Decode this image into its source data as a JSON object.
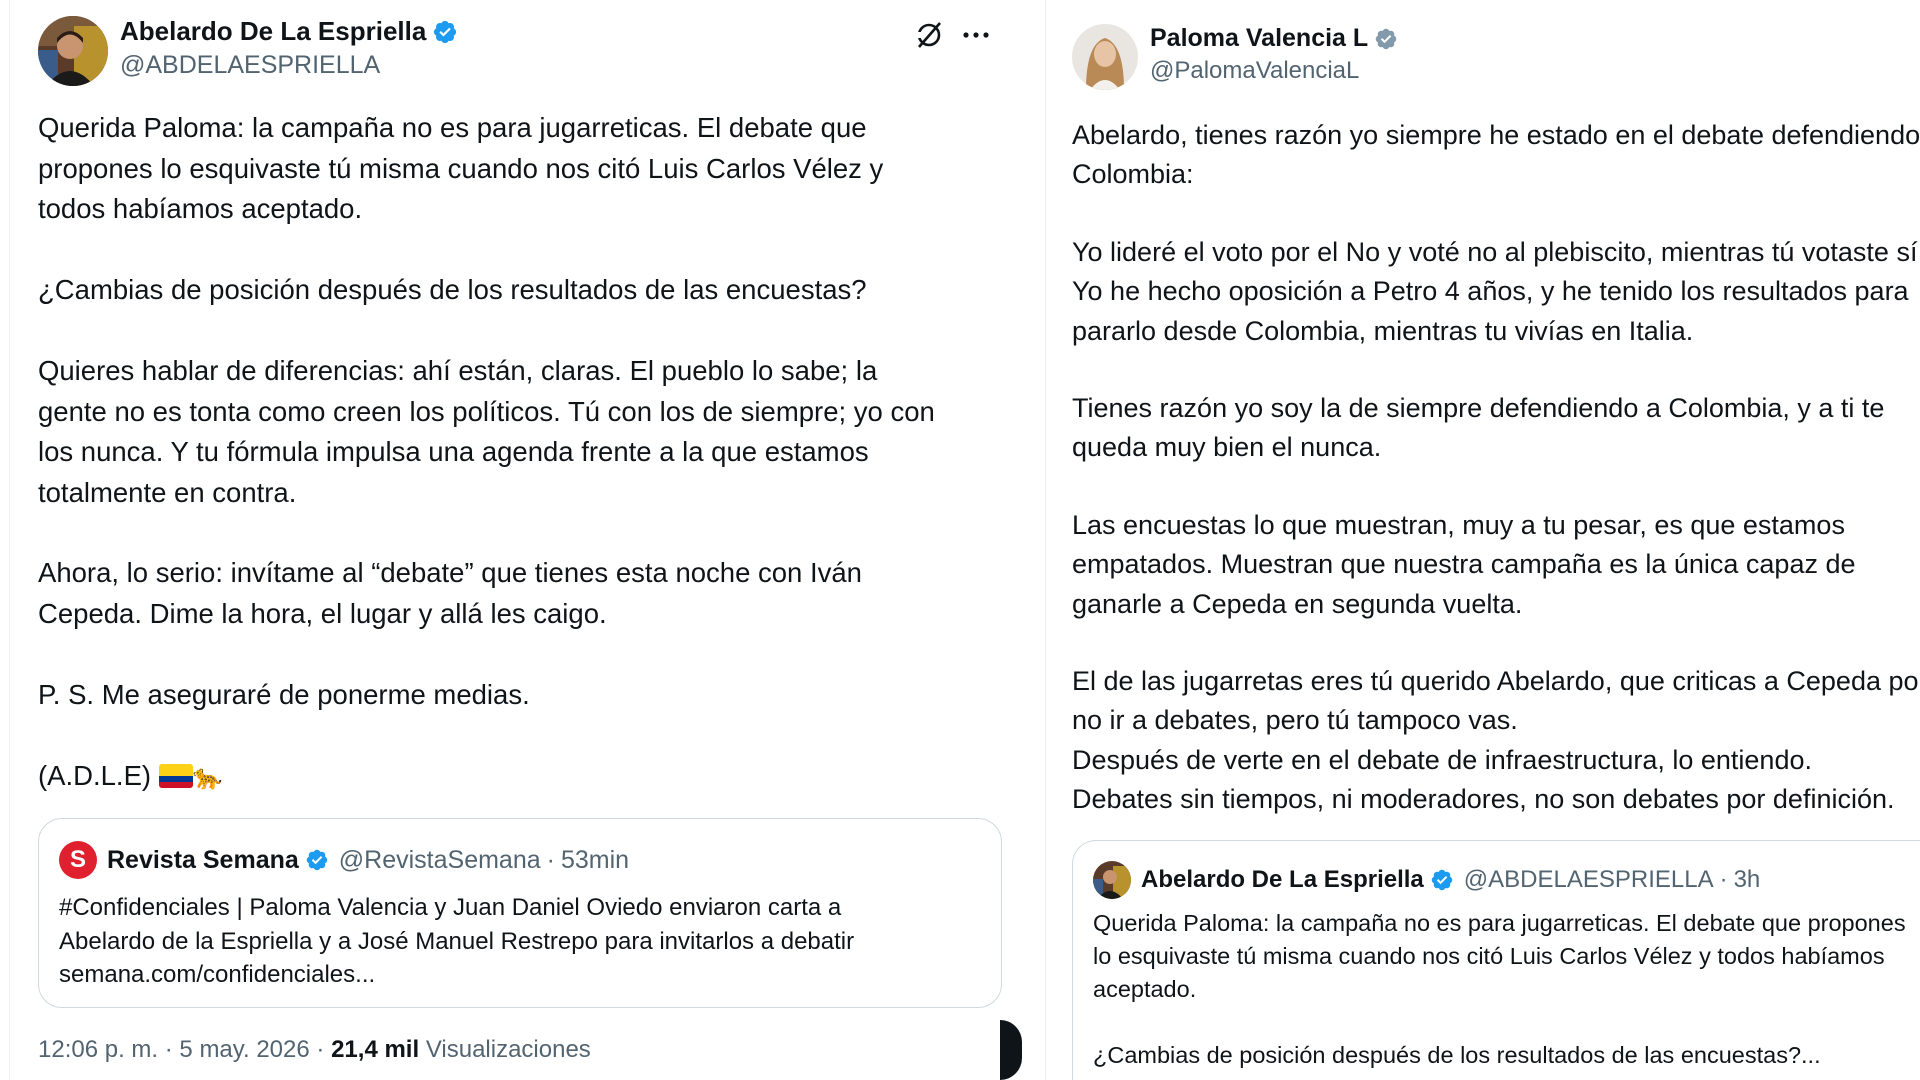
{
  "left_post": {
    "author": {
      "name": "Abelardo De La Espriella",
      "handle": "@ABDELAESPRIELLA",
      "verified": true
    },
    "paragraphs": [
      "Querida Paloma: la campaña no es para jugarreticas. El debate que\npropones lo esquivaste tú misma cuando nos citó Luis Carlos Vélez y\ntodos habíamos aceptado.",
      "¿Cambias de posición después de los resultados de las encuestas?",
      "Quieres hablar de diferencias: ahí están, claras. El pueblo lo sabe; la\ngente no es tonta como creen los políticos. Tú con los de siempre; yo con\nlos nunca. Y tu fórmula impulsa una agenda frente a la que estamos\ntotalmente en contra.",
      "Ahora, lo serio: invítame al “debate” que tienes esta noche con Iván\nCepeda. Dime la hora, el lugar y allá les caigo.",
      "P. S. Me aseguraré de ponerme medias.",
      "(A.D.L.E)"
    ],
    "signature_emojis": [
      "colombia-flag",
      "jaguar"
    ],
    "jaguar_glyph": "🐆",
    "quoted": {
      "source_initial": "S",
      "name": "Revista Semana",
      "handle": "@RevistaSemana",
      "time": "53min",
      "text": "#Confidenciales | Paloma Valencia y Juan Daniel Oviedo enviaron carta a\nAbelardo de la Espriella y a José Manuel Restrepo para invitarlos a debatir\nsemana.com/confidenciales..."
    },
    "meta": {
      "time": "12:06 p. m.",
      "date": "5 may. 2026",
      "views_count": "21,4 mil",
      "views_label": "Visualizaciones"
    },
    "separator": "·"
  },
  "right_post": {
    "author": {
      "name": "Paloma Valencia L",
      "handle": "@PalomaValenciaL",
      "verified": true
    },
    "paragraphs": [
      "Abelardo, tienes razón yo siempre he estado en el debate defendiendo a\nColombia:",
      "Yo lideré el voto por el No y voté no al plebiscito, mientras tú votaste sí.\nYo he hecho oposición a Petro 4 años, y he tenido los resultados para\npararlo desde Colombia, mientras tu vivías en Italia.",
      "Tienes razón yo soy la de siempre defendiendo a Colombia, y a ti te\nqueda muy bien el nunca.",
      "Las encuestas lo que muestran, muy a tu pesar, es que estamos\nempatados. Muestran que nuestra campaña es la única capaz de\nganarle a Cepeda en segunda vuelta.",
      "El de las jugarretas eres tú querido Abelardo, que criticas a Cepeda por\nno ir a debates, pero tú tampoco vas.\nDespués de verte en el debate de infraestructura, lo entiendo.\nDebates sin tiempos, ni moderadores, no son debates por definición."
    ],
    "quoted": {
      "name": "Abelardo De La Espriella",
      "handle": "@ABDELAESPRIELLA",
      "time": "3h",
      "text": "Querida Paloma: la campaña no es para jugarreticas. El debate que propones\nlo esquivaste tú misma cuando nos citó Luis Carlos Vélez y todos habíamos\naceptado.\n\n¿Cambias de posición después de los resultados de las encuestas?..."
    },
    "separator": "·"
  },
  "colors": {
    "text": "#0f1419",
    "secondary": "#536471",
    "verified_blue": "#1d9bf0",
    "verified_gray": "#829aab",
    "border": "#cfd9de",
    "semana_red": "#e0202e"
  },
  "icons": [
    "grok-icon",
    "more-icon",
    "verified-icon"
  ]
}
